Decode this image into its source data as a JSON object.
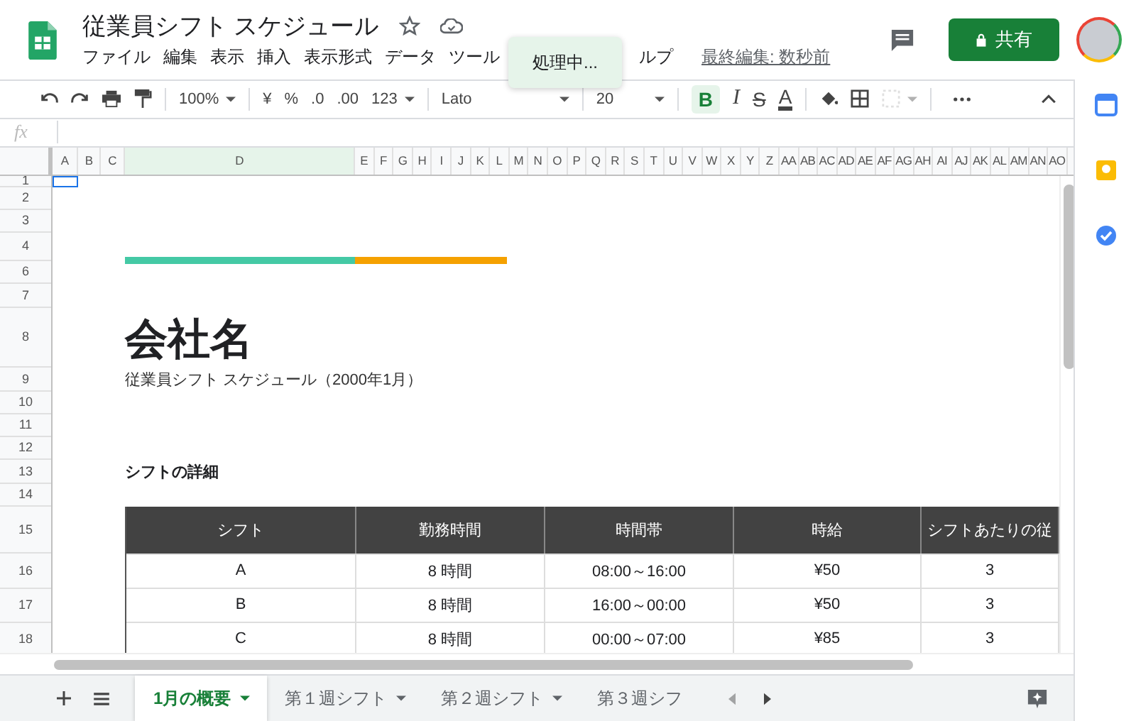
{
  "doc": {
    "title": "従業員シフト スケジュール",
    "menu": [
      "ファイル",
      "編集",
      "表示",
      "挿入",
      "表示形式",
      "データ",
      "ツール",
      "ルプ"
    ],
    "last_edit": "最終編集: 数秒前",
    "share_label": "共有",
    "toast": "処理中..."
  },
  "toolbar": {
    "zoom": "100%",
    "currency": "¥",
    "percent": "%",
    "dec_less": ".0",
    "dec_more": ".00",
    "number_format": "123",
    "font": "Lato",
    "font_size": "20",
    "bold": "B",
    "bold_on": true,
    "italic": "I",
    "strike": "S",
    "text_color": "A"
  },
  "formula_bar": {
    "fx": "fx"
  },
  "columns": [
    {
      "label": "A",
      "selected": false
    },
    {
      "label": "B",
      "selected": false
    },
    {
      "label": "C",
      "selected": false
    },
    {
      "label": "D",
      "selected": true
    },
    {
      "label": "E",
      "selected": false
    },
    {
      "label": "F",
      "selected": false
    },
    {
      "label": "G",
      "selected": false
    },
    {
      "label": "H",
      "selected": false
    },
    {
      "label": "I",
      "selected": false
    },
    {
      "label": "J",
      "selected": false
    },
    {
      "label": "K",
      "selected": false
    },
    {
      "label": "L",
      "selected": false
    },
    {
      "label": "M",
      "selected": false
    },
    {
      "label": "N",
      "selected": false
    },
    {
      "label": "O",
      "selected": false
    },
    {
      "label": "P",
      "selected": false
    },
    {
      "label": "Q",
      "selected": false
    },
    {
      "label": "R",
      "selected": false
    },
    {
      "label": "S",
      "selected": false
    },
    {
      "label": "T",
      "selected": false
    },
    {
      "label": "U",
      "selected": false
    },
    {
      "label": "V",
      "selected": false
    },
    {
      "label": "W",
      "selected": false
    },
    {
      "label": "X",
      "selected": false
    },
    {
      "label": "Y",
      "selected": false
    },
    {
      "label": "Z",
      "selected": false
    },
    {
      "label": "AA",
      "selected": false
    },
    {
      "label": "AB",
      "selected": false
    },
    {
      "label": "AC",
      "selected": false
    },
    {
      "label": "AD",
      "selected": false
    },
    {
      "label": "AE",
      "selected": false
    },
    {
      "label": "AF",
      "selected": false
    },
    {
      "label": "AG",
      "selected": false
    },
    {
      "label": "AH",
      "selected": false
    },
    {
      "label": "AI",
      "selected": false
    },
    {
      "label": "AJ",
      "selected": false
    },
    {
      "label": "AK",
      "selected": false
    },
    {
      "label": "AL",
      "selected": false
    },
    {
      "label": "AM",
      "selected": false
    },
    {
      "label": "AN",
      "selected": false
    },
    {
      "label": "AO",
      "selected": false
    }
  ],
  "rows": [
    "1",
    "2",
    "3",
    "4",
    "6",
    "7",
    "8",
    "9",
    "10",
    "11",
    "12",
    "13",
    "14",
    "15",
    "16",
    "17",
    "18"
  ],
  "sheet": {
    "accent_bars": [
      {
        "color": "#44c9a5"
      },
      {
        "color": "#f5a100"
      }
    ],
    "company": "会社名",
    "subtitle": "従業員シフト スケジュール（2000年1月）",
    "section": "シフトの詳細",
    "table": {
      "columns": [
        "シフト",
        "勤務時間",
        "時間帯",
        "時給",
        "シフトあたりの従"
      ],
      "rows": [
        [
          "A",
          "8 時間",
          "08:00～16:00",
          "¥50",
          "3"
        ],
        [
          "B",
          "8 時間",
          "16:00～00:00",
          "¥50",
          "3"
        ],
        [
          "C",
          "8 時間",
          "00:00～07:00",
          "¥85",
          "3"
        ]
      ]
    }
  },
  "tabs": [
    {
      "label": "1月の概要",
      "selected": true
    },
    {
      "label": "第１週シフト",
      "selected": false
    },
    {
      "label": "第２週シフト",
      "selected": false
    },
    {
      "label": "第３週シフ",
      "selected": false
    }
  ]
}
